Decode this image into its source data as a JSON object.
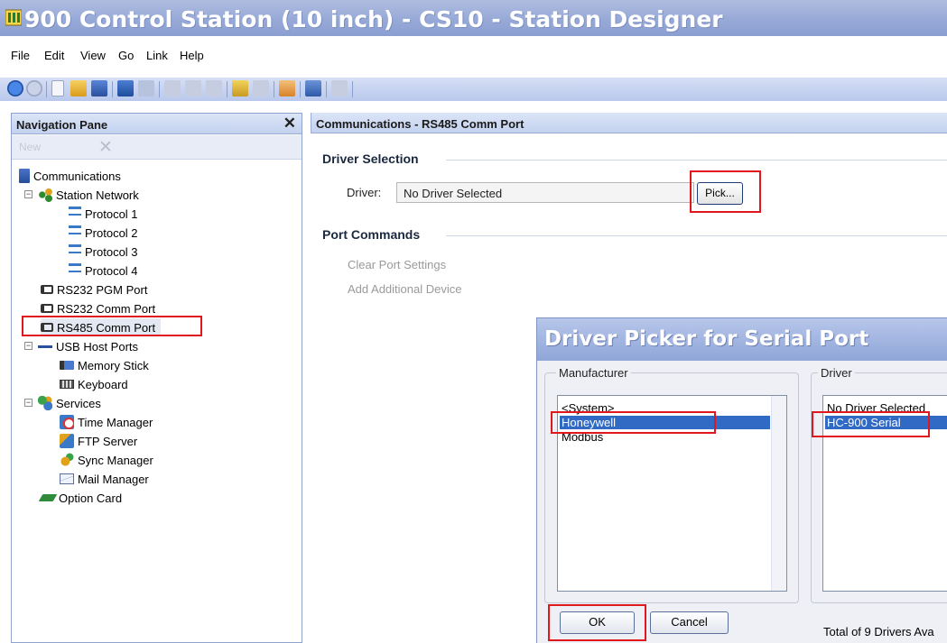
{
  "window": {
    "title": "900 Control Station (10 inch) - CS10 - Station Designer"
  },
  "menu": [
    "File",
    "Edit",
    "View",
    "Go",
    "Link",
    "Help"
  ],
  "nav": {
    "title": "Navigation Pane",
    "ghost_label": "New",
    "tree": [
      {
        "label": "Communications",
        "icon": "communications-icon"
      },
      {
        "label": "Station Network",
        "icon": "network-icon"
      },
      {
        "label": "Protocol 1",
        "icon": "protocol-icon"
      },
      {
        "label": "Protocol 2",
        "icon": "protocol-icon"
      },
      {
        "label": "Protocol 3",
        "icon": "protocol-icon"
      },
      {
        "label": "Protocol 4",
        "icon": "protocol-icon"
      },
      {
        "label": "RS232 PGM Port",
        "icon": "port-icon"
      },
      {
        "label": "RS232 Comm Port",
        "icon": "port-icon"
      },
      {
        "label": "RS485 Comm Port",
        "icon": "port-icon"
      },
      {
        "label": "USB Host Ports",
        "icon": "usb-icon"
      },
      {
        "label": "Memory Stick",
        "icon": "memory-stick-icon"
      },
      {
        "label": "Keyboard",
        "icon": "keyboard-icon"
      },
      {
        "label": "Services",
        "icon": "services-icon"
      },
      {
        "label": "Time Manager",
        "icon": "time-manager-icon"
      },
      {
        "label": "FTP Server",
        "icon": "ftp-server-icon"
      },
      {
        "label": "Sync Manager",
        "icon": "sync-manager-icon"
      },
      {
        "label": "Mail Manager",
        "icon": "mail-manager-icon"
      },
      {
        "label": "Option Card",
        "icon": "option-card-icon"
      }
    ]
  },
  "main": {
    "title": "Communications - RS485 Comm Port",
    "driver_section": "Driver Selection",
    "driver_label": "Driver:",
    "driver_value": "No Driver Selected",
    "pick_label": "Pick...",
    "port_section": "Port Commands",
    "commands": [
      "Clear Port Settings",
      "Add Additional Device"
    ]
  },
  "dialog": {
    "title": "Driver Picker for Serial Port",
    "manufacturer_label": "Manufacturer",
    "manufacturers": [
      "<System>",
      "Honeywell",
      "Modbus"
    ],
    "manufacturer_selected": "Honeywell",
    "driver_label": "Driver",
    "drivers": [
      "No Driver Selected",
      "HC-900 Serial"
    ],
    "driver_selected": "HC-900 Serial",
    "ok_label": "OK",
    "cancel_label": "Cancel",
    "total_text": "Total of 9 Drivers Ava"
  },
  "colors": {
    "highlight": "#e0181e",
    "selection": "#316ac5",
    "title_text": "#ffffff"
  }
}
